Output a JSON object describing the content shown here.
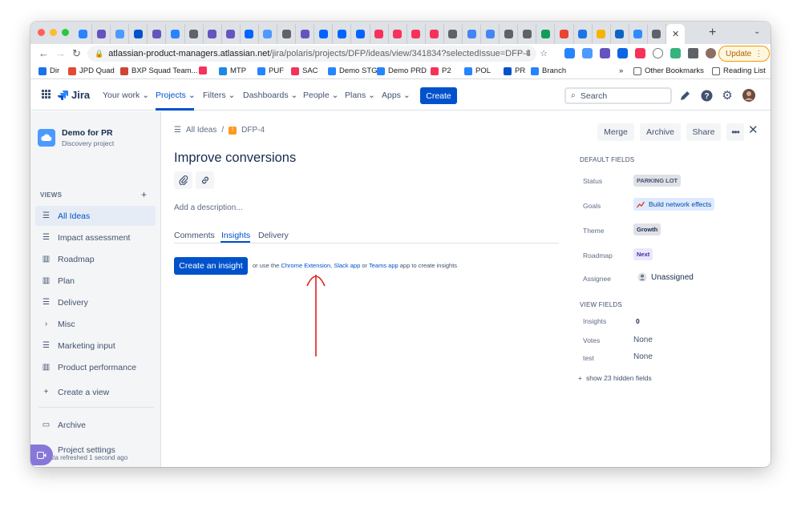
{
  "browser": {
    "url_host": "atlassian-product-managers.atlassian.net",
    "url_path": "/jira/polaris/projects/DFP/ideas/view/341834?selectedIssue=DFP-4",
    "update_label": "Update",
    "bookmarks": [
      {
        "label": "Dir",
        "color": "#1a73e8"
      },
      {
        "label": "JPD Quad",
        "color": "#e34a33"
      },
      {
        "label": "BXP Squad Team...",
        "color": "#d04437"
      },
      {
        "label": "",
        "color": "#f6325a"
      },
      {
        "label": "MTP",
        "color": "#1e88e5"
      },
      {
        "label": "PUF",
        "color": "#2684ff"
      },
      {
        "label": "SAC",
        "color": "#f6325a"
      },
      {
        "label": "Demo STG",
        "color": "#2684ff"
      },
      {
        "label": "Demo PRD",
        "color": "#2684ff"
      },
      {
        "label": "P2",
        "color": "#f6325a"
      },
      {
        "label": "POL",
        "color": "#2684ff"
      },
      {
        "label": "PR",
        "color": "#0052cc"
      },
      {
        "label": "Branch",
        "color": "#2684ff"
      }
    ],
    "bookmarks_overflow": "»",
    "other_bookmarks": "Other Bookmarks",
    "reading_list": "Reading List"
  },
  "jira_nav": {
    "logo": "Jira",
    "items": [
      "Your work",
      "Projects",
      "Filters",
      "Dashboards",
      "People",
      "Plans",
      "Apps"
    ],
    "create_label": "Create",
    "search_placeholder": "Search"
  },
  "sidebar": {
    "project_name": "Demo for PR",
    "project_type": "Discovery project",
    "views_label": "VIEWS",
    "items": [
      {
        "label": "All Ideas",
        "icon": "list-icon"
      },
      {
        "label": "Impact assessment",
        "icon": "list-icon"
      },
      {
        "label": "Roadmap",
        "icon": "board-icon"
      },
      {
        "label": "Plan",
        "icon": "board-icon"
      },
      {
        "label": "Delivery",
        "icon": "list-icon"
      },
      {
        "label": "Misc",
        "icon": "chevron-right-icon"
      },
      {
        "label": "Marketing input",
        "icon": "list-icon"
      },
      {
        "label": "Product performance",
        "icon": "board-icon"
      },
      {
        "label": "Create a view",
        "icon": "plus-icon"
      }
    ],
    "archive": "Archive",
    "project_settings": "Project settings",
    "refreshed": "Data refreshed 1 second ago"
  },
  "issue": {
    "breadcrumb_all": "All Ideas",
    "breadcrumb_sep": "/",
    "key": "DFP-4",
    "title": "Improve conversions",
    "description_placeholder": "Add a description...",
    "tabs": [
      "Comments",
      "Insights",
      "Delivery"
    ],
    "create_insight": "Create an insight",
    "insight_help_prefix": "or use the",
    "chrome_extension": "Chrome Extension",
    "slack_app": "Slack app",
    "help_or": "or",
    "teams_app": "Teams app",
    "insight_help_suffix": "app to create insights",
    "actions": {
      "merge": "Merge",
      "archive": "Archive",
      "share": "Share"
    }
  },
  "fields": {
    "default_label": "DEFAULT FIELDS",
    "status_label": "Status",
    "status_value": "PARKING LOT",
    "goals_label": "Goals",
    "goals_value": "Build network effects",
    "theme_label": "Theme",
    "theme_value": "Growth",
    "roadmap_label": "Roadmap",
    "roadmap_value": "Next",
    "assignee_label": "Assignee",
    "assignee_value": "Unassigned",
    "view_label": "VIEW FIELDS",
    "insights_label": "Insights",
    "insights_value": "0",
    "votes_label": "Votes",
    "votes_value": "None",
    "test_label": "test",
    "test_value": "None",
    "show_hidden": "show 23 hidden fields"
  },
  "colors": {
    "primary": "#0052cc",
    "annotation": "#e01e1e"
  }
}
